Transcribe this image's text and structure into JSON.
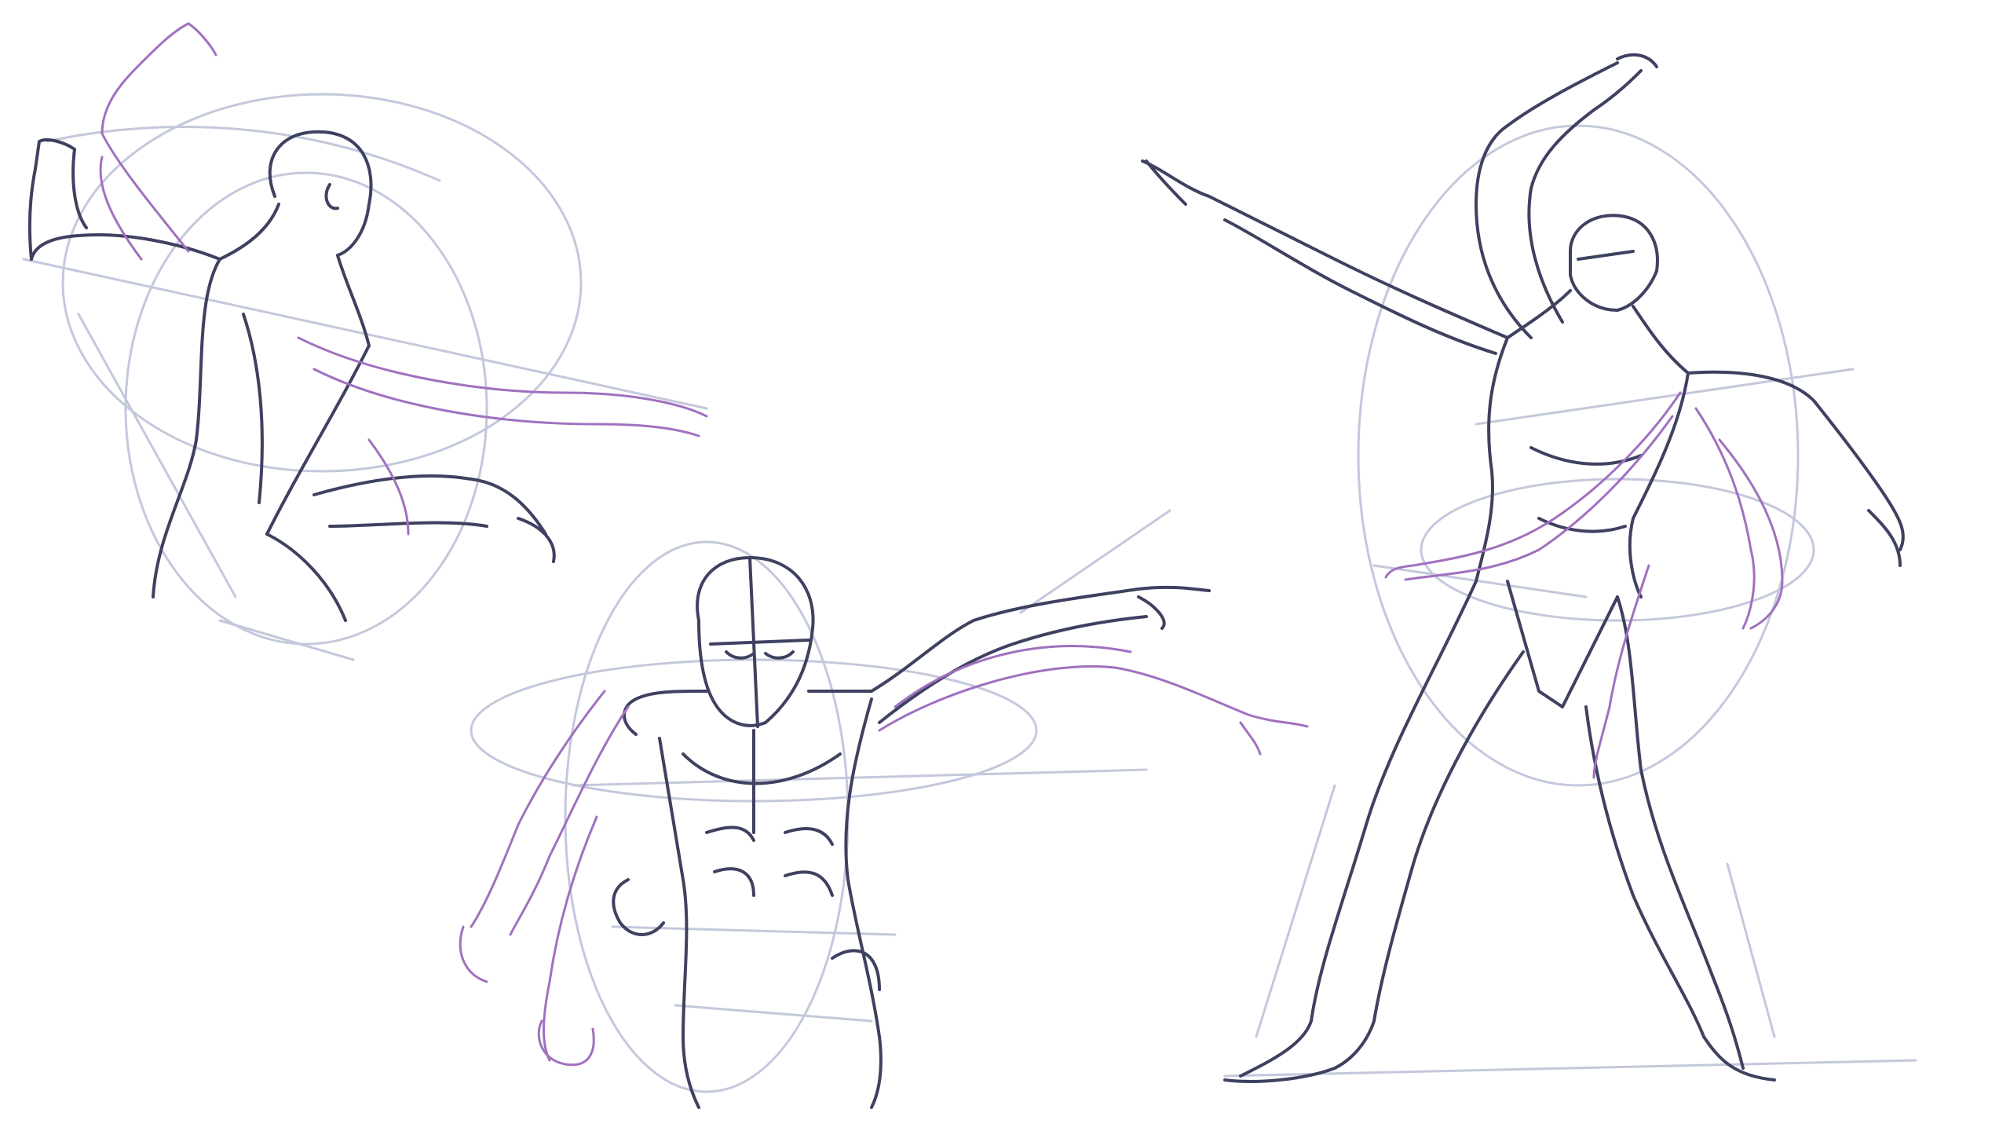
{
  "colors": {
    "background": "#ffffff",
    "construction": "#c3c8dc",
    "ink": "#3e4160",
    "alternate_pose": "#a070bf"
  },
  "figures": [
    {
      "name": "twisting-back-figure",
      "pose": "upper-body-three-quarter-back-view"
    },
    {
      "name": "front-torso-pointing-figure",
      "pose": "front-view-torso-arm-extended"
    },
    {
      "name": "full-body-lunge-figure",
      "pose": "full-body-wide-stance-arm-raised"
    }
  ]
}
